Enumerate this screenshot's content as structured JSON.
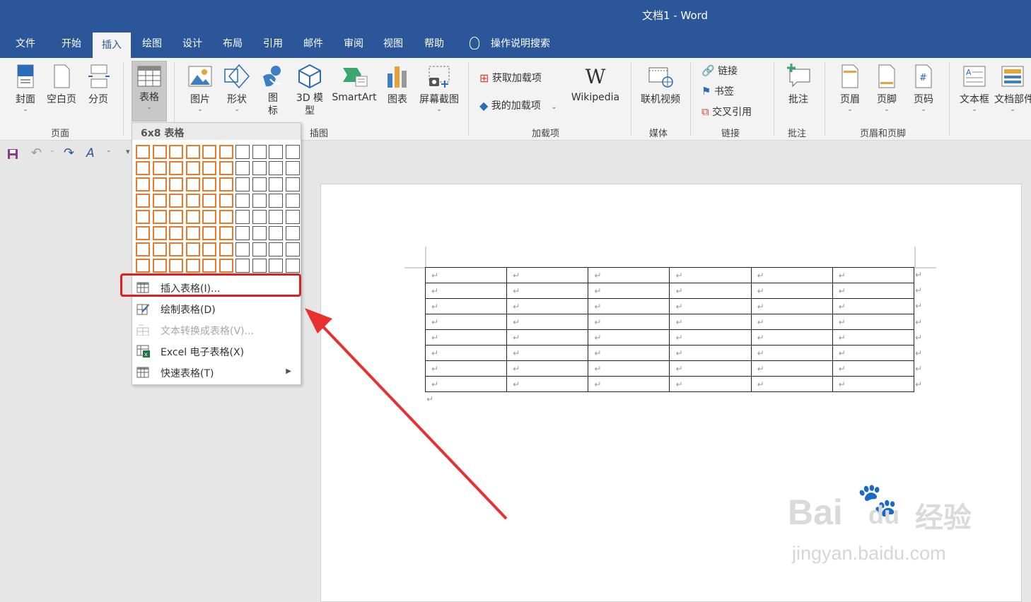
{
  "app": {
    "title": "文档1  -  Word"
  },
  "tabs": [
    {
      "label": "文件"
    },
    {
      "label": "开始"
    },
    {
      "label": "插入",
      "active": true
    },
    {
      "label": "绘图"
    },
    {
      "label": "设计"
    },
    {
      "label": "布局"
    },
    {
      "label": "引用"
    },
    {
      "label": "邮件"
    },
    {
      "label": "审阅"
    },
    {
      "label": "视图"
    },
    {
      "label": "帮助"
    },
    {
      "label": "操作说明搜索"
    }
  ],
  "ribbon": {
    "pages": {
      "cover": "封面",
      "blank": "空白页",
      "break": "分页",
      "group": "页面"
    },
    "table": {
      "label": "表格"
    },
    "illustrations": {
      "picture": "图片",
      "shape": "形状",
      "icon1": "图",
      "icon2": "标",
      "model1": "3D 模",
      "model2": "型",
      "smartart": "SmartArt",
      "chart": "图表",
      "screenshot": "屏幕截图",
      "group": "插图"
    },
    "addins": {
      "get": "获取加载项",
      "mine": "我的加载项",
      "wikipedia": "Wikipedia",
      "group": "加载项"
    },
    "media": {
      "video": "联机视频",
      "group": "媒体"
    },
    "links": {
      "link": "链接",
      "bookmark": "书签",
      "crossref": "交叉引用",
      "group": "链接"
    },
    "comments": {
      "comment": "批注",
      "group": "批注"
    },
    "headerfooter": {
      "header": "页眉",
      "footer": "页脚",
      "pagenum": "页码",
      "group": "页眉和页脚"
    },
    "text": {
      "textbox": "文本框",
      "parts": "文档部件"
    }
  },
  "table_menu": {
    "grid_label": "6x8 表格",
    "grid": {
      "cols": 10,
      "rows": 8,
      "selected_cols": 6,
      "selected_rows": 8
    },
    "items": [
      {
        "label": "插入表格(I)..."
      },
      {
        "label": "绘制表格(D)"
      },
      {
        "label": "文本转换成表格(V)..."
      },
      {
        "label": "Excel 电子表格(X)"
      },
      {
        "label": "快速表格(T)"
      }
    ]
  },
  "document": {
    "table": {
      "rows": 8,
      "cols": 6,
      "cell_mark": "↵"
    },
    "para_mark": "↵"
  },
  "watermark": {
    "brand": "Bai",
    "brand2": "du",
    "brand3": "经验",
    "url": "jingyan.baidu.com"
  },
  "colors": {
    "accent": "#2b579a",
    "grid_selected": "#e87a2e",
    "highlight": "#e02020"
  }
}
